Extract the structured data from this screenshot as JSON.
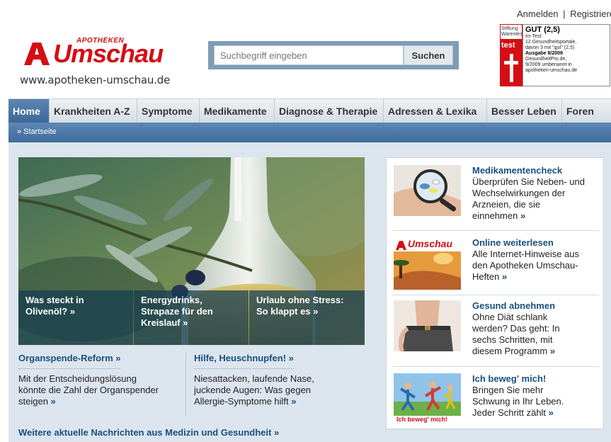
{
  "header": {
    "login_label": "Anmelden",
    "separator": "|",
    "register_label": "Registrieren",
    "logo": {
      "top_text": "APOTHEKEN",
      "word": "Umschau",
      "url": "www.apotheken-umschau.de"
    },
    "search": {
      "placeholder": "Suchbegriff eingeben",
      "button_label": "Suchen"
    },
    "test_badge": {
      "org_line1": "Stiftung",
      "org_line2": "Warentest",
      "test_word": "test",
      "grade": "GUT (2,5)",
      "line1": "Im Test:",
      "line2": "12 Gesundheitsportale,",
      "line3": "davon 3 mit \"gut\" (2,5)",
      "issue": "Ausgabe 6/2009",
      "note1": "GesundheitPro.de,",
      "note2": "9/2009 umbenannt in",
      "note3": "apotheken-umschau.de"
    }
  },
  "nav": {
    "items": [
      "Home",
      "Krankheiten A-Z",
      "Symptome",
      "Medikamente",
      "Diagnose & Therapie",
      "Adressen & Lexika",
      "Besser Leben",
      "Foren"
    ],
    "breadcrumb": "» Startseite"
  },
  "hero": {
    "captions": [
      {
        "line1": "Was steckt in",
        "line2": "Olivenöl? »"
      },
      {
        "line1": "Energydrinks,",
        "line2": "Strapaze für den",
        "line3": "Kreislauf »"
      },
      {
        "line1": "Urlaub ohne Stress:",
        "line2": "So klappt es »"
      }
    ]
  },
  "news": [
    {
      "title": "Organspende-Reform »",
      "line1": "Mit der Entscheidungslösung",
      "line2": "könnte die Zahl der Organspender",
      "line3": "steigen",
      "more": "»"
    },
    {
      "title": "Hilfe, Heuschnupfen! »",
      "line1": "Niesattacken, laufende Nase,",
      "line2": "juckende Augen: Was gegen",
      "line3": "Allergie-Symptome hilft",
      "more": "»"
    }
  ],
  "more_news": "Weitere aktuelle Nachrichten aus Medizin und Gesundheit »",
  "panel": {
    "teasers": [
      {
        "title": "Medikamentencheck",
        "lines": [
          "Überprüfen Sie Neben- und",
          "Wechselwirkungen der",
          "Arzneien, die sie",
          "einnehmen"
        ],
        "more": "»"
      },
      {
        "title": "Online weiterlesen",
        "lines": [
          "Alle Internet-Hinweise aus",
          "den Apotheken Umschau-",
          "Heften"
        ],
        "more": "»",
        "thumb_logo": "Umschau"
      },
      {
        "title": "Gesund abnehmen",
        "lines": [
          "Ohne Diät schlank",
          "werden? Das geht: In",
          "sechs Schritten, mit",
          "diesem Programm"
        ],
        "more": "»"
      },
      {
        "title": "Ich beweg' mich!",
        "lines": [
          "Bringen Sie mehr",
          "Schwung in Ihr Leben.",
          "Jeder Schritt zählt"
        ],
        "more": "»",
        "thumb_label": "Ich beweg' mich!"
      }
    ]
  },
  "colors": {
    "brand_red": "#d40e14",
    "link_blue": "#1a4f7e",
    "nav_active": "#3b6797",
    "content_bg": "#dce5ed"
  }
}
